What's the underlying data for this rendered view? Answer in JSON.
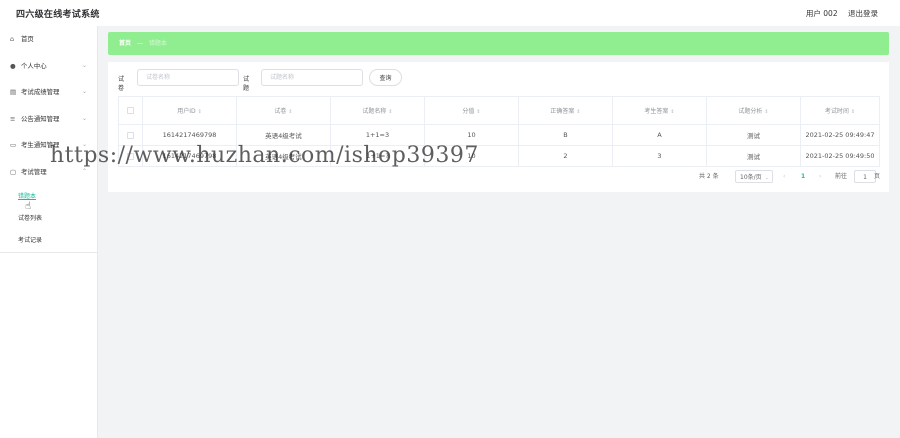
{
  "header": {
    "app_title": "四六级在线考试系统",
    "user_label": "用户 002",
    "logout_label": "退出登录"
  },
  "sidebar": {
    "items": [
      {
        "label": "首页",
        "icon": "home-icon"
      },
      {
        "label": "个人中心",
        "icon": "user-icon"
      },
      {
        "label": "考试成绩管理",
        "icon": "table-icon"
      },
      {
        "label": "公告通知管理",
        "icon": "list-icon"
      },
      {
        "label": "考生通知管理",
        "icon": "message-icon"
      },
      {
        "label": "考试管理",
        "icon": "document-icon"
      }
    ],
    "submenu": [
      {
        "label": "错题本",
        "active": true
      },
      {
        "label": "试卷列表",
        "active": false
      },
      {
        "label": "考试记录",
        "active": false
      }
    ]
  },
  "breadcrumb": {
    "home": "首页",
    "separator": "—",
    "current": "错题本"
  },
  "search": {
    "paper_label": "试卷",
    "paper_placeholder": "试卷名称",
    "question_label": "试题",
    "question_placeholder": "试题名称",
    "button_label": "查询"
  },
  "table": {
    "columns": [
      "用户ID",
      "试卷",
      "试题名称",
      "分值",
      "正确答案",
      "考生答案",
      "试题分析",
      "考试时间"
    ],
    "rows": [
      [
        "1614217469798",
        "英语4级考试",
        "1+1=3",
        "10",
        "B",
        "A",
        "测试",
        "2021-02-25 09:49:47"
      ],
      [
        "1614217469798",
        "英语4级考试",
        "1+1=?",
        "10",
        "2",
        "3",
        "测试",
        "2021-02-25 09:49:50"
      ]
    ]
  },
  "pagination": {
    "total": "共 2 条",
    "page_size": "10条/页",
    "current_page": "1",
    "goto_label": "前往",
    "goto_value": "1",
    "page_suffix": "页"
  },
  "watermark": "https://www.huzhan.com/ishop39397",
  "colors": {
    "accent": "#1abc9c",
    "breadcrumb_bg": "#90ee90"
  }
}
